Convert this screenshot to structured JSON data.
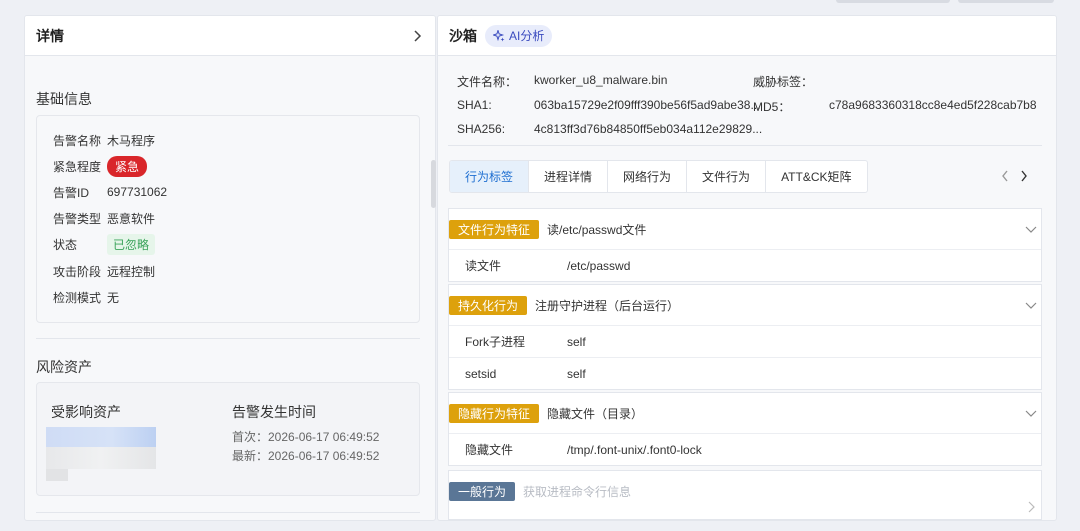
{
  "left": {
    "title": "详情",
    "basic": {
      "title": "基础信息",
      "rows": [
        {
          "key": "告警名称",
          "value": "木马程序"
        },
        {
          "key": "紧急程度",
          "value": "紧急"
        },
        {
          "key": "告警ID",
          "value": "697731062"
        },
        {
          "key": "告警类型",
          "value": "恶意软件"
        },
        {
          "key": "状态",
          "value": "已忽略"
        },
        {
          "key": "攻击阶段",
          "value": "远程控制"
        },
        {
          "key": "检测模式",
          "value": "无"
        }
      ]
    },
    "risk": {
      "title": "风险资产",
      "asset_label": "受影响资产",
      "time_label": "告警发生时间",
      "first": "首次：2026-06-17 06:49:52",
      "latest": "最新：2026-06-17 06:49:52"
    }
  },
  "right": {
    "title": "沙箱",
    "ai_label": "AI分析",
    "meta": {
      "filename_k": "文件名称：",
      "filename_v": "kworker_u8_malware.bin",
      "threat_k": "威胁标签：",
      "sha1_k": "SHA1:",
      "sha1_v": "063ba15729e2f09fff390be56f5ad9abe38...",
      "md5_k": "MD5：",
      "md5_v": "c78a9683360318cc8e4ed5f228cab7b8",
      "sha256_k": "SHA256:",
      "sha256_v": "4c813ff3d76b84850ff5eb034a112e29829..."
    },
    "tabs": [
      "行为标签",
      "进程详情",
      "网络行为",
      "文件行为",
      "ATT&CK矩阵"
    ],
    "groups": [
      {
        "tag": "文件行为特征",
        "title": "读/etc/passwd文件",
        "rows": [
          {
            "k": "读文件",
            "v": "/etc/passwd"
          }
        ]
      },
      {
        "tag": "持久化行为",
        "title": "注册守护进程（后台运行）",
        "rows": [
          {
            "k": "Fork子进程",
            "v": "self"
          },
          {
            "k": "setsid",
            "v": "self"
          }
        ]
      },
      {
        "tag": "隐藏行为特征",
        "title": "隐藏文件（目录）",
        "rows": [
          {
            "k": "隐藏文件",
            "v": "/tmp/.font-unix/.font0-lock"
          }
        ]
      },
      {
        "tag": "一般行为",
        "title": "获取进程命令行信息"
      }
    ]
  },
  "colors": {
    "accent": "#1f6fd1",
    "urgent": "#d9262a",
    "tag_orange": "#dda10c",
    "tag_gray": "#5a7696"
  }
}
